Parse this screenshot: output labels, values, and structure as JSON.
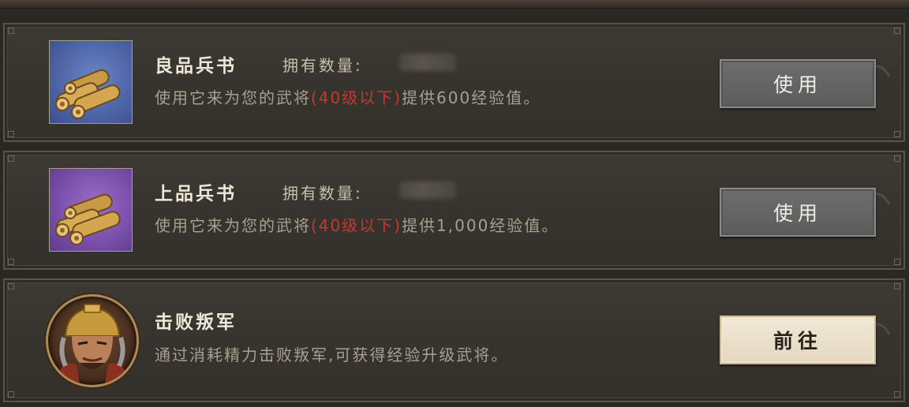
{
  "items": [
    {
      "title": "良品兵书",
      "own_label": "拥有数量:",
      "desc_prefix": "使用它来为您的武将",
      "desc_highlight": "(40级以下)",
      "desc_suffix": "提供600经验值。",
      "button_label": "使用",
      "icon": "scroll-bundle-icon",
      "icon_bg_color": "#5368ad"
    },
    {
      "title": "上品兵书",
      "own_label": "拥有数量:",
      "desc_prefix": "使用它来为您的武将",
      "desc_highlight": "(40级以下)",
      "desc_suffix": "提供1,000经验值。",
      "button_label": "使用",
      "icon": "scroll-bundle-icon",
      "icon_bg_color": "#7c50ad"
    },
    {
      "title": "击败叛军",
      "desc": "通过消耗精力击败叛军,可获得经验升级武将。",
      "button_label": "前往",
      "icon": "rebel-general-avatar"
    }
  ],
  "colors": {
    "highlight_red": "#c23a2e",
    "panel_bg": "#3a3631",
    "gray_button": "#666666",
    "light_button": "#ede3cf"
  }
}
